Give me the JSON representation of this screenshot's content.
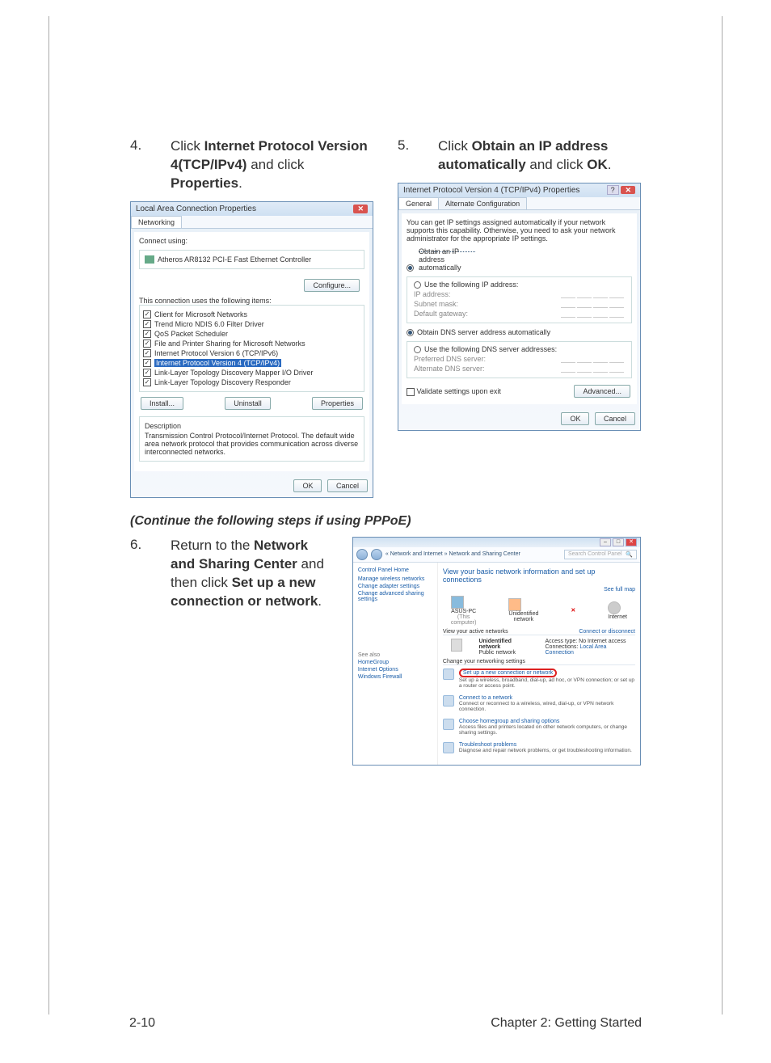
{
  "steps": {
    "s4": {
      "num": "4.",
      "text_pre": "Click ",
      "b1": "Internet Protocol Version 4(TCP/IPv4)",
      "mid": " and click ",
      "b2": "Properties",
      "post": "."
    },
    "s5": {
      "num": "5.",
      "text_pre": "Click ",
      "b1": "Obtain an IP address automatically",
      "mid": " and click ",
      "b2": "OK",
      "post": "."
    },
    "s6": {
      "num": "6.",
      "text_pre": "Return to the ",
      "b1": "Network and Sharing Center",
      "mid": " and then click ",
      "b2": "Set up a new connection or network",
      "post": "."
    }
  },
  "continue_note": "(Continue the following steps if using PPPoE)",
  "dlg1": {
    "title": "Local Area Connection Properties",
    "tab": "Networking",
    "connect_using": "Connect using:",
    "adapter": "Atheros AR8132 PCI-E Fast Ethernet Controller",
    "configure": "Configure...",
    "uses": "This connection uses the following items:",
    "items": [
      "Client for Microsoft Networks",
      "Trend Micro NDIS 6.0 Filter Driver",
      "QoS Packet Scheduler",
      "File and Printer Sharing for Microsoft Networks",
      "Internet Protocol Version 6 (TCP/IPv6)",
      "Internet Protocol Version 4 (TCP/IPv4)",
      "Link-Layer Topology Discovery Mapper I/O Driver",
      "Link-Layer Topology Discovery Responder"
    ],
    "install": "Install...",
    "uninstall": "Uninstall",
    "properties": "Properties",
    "desc_h": "Description",
    "desc": "Transmission Control Protocol/Internet Protocol. The default wide area network protocol that provides communication across diverse interconnected networks.",
    "ok": "OK",
    "cancel": "Cancel"
  },
  "dlg2": {
    "title": "Internet Protocol Version 4 (TCP/IPv4) Properties",
    "tab1": "General",
    "tab2": "Alternate Configuration",
    "intro": "You can get IP settings assigned automatically if your network supports this capability. Otherwise, you need to ask your network administrator for the appropriate IP settings.",
    "r_auto": "Obtain an IP address automatically",
    "r_use": "Use the following IP address:",
    "ip": "IP address:",
    "subnet": "Subnet mask:",
    "gw": "Default gateway:",
    "dns_auto": "Obtain DNS server address automatically",
    "dns_use": "Use the following DNS server addresses:",
    "pdns": "Preferred DNS server:",
    "adns": "Alternate DNS server:",
    "validate": "Validate settings upon exit",
    "advanced": "Advanced...",
    "ok": "OK",
    "cancel": "Cancel"
  },
  "cp": {
    "crumb": "« Network and Internet » Network and Sharing Center",
    "search_ph": "Search Control Panel",
    "side_home": "Control Panel Home",
    "side": [
      "Manage wireless networks",
      "Change adapter settings",
      "Change advanced sharing settings"
    ],
    "see_also": "See also",
    "see": [
      "HomeGroup",
      "Internet Options",
      "Windows Firewall"
    ],
    "h1": "View your basic network information and set up connections",
    "full_map": "See full map",
    "map": {
      "pc": "ASUS-PC",
      "pcsub": "(This computer)",
      "net": "Unidentified network",
      "inet": "Internet"
    },
    "active_h": "View your active networks",
    "connect_disc": "Connect or disconnect",
    "unid": "Unidentified network",
    "pub": "Public network",
    "access_l": "Access type:",
    "access_v": "No Internet access",
    "conn_l": "Connections:",
    "conn_v": "Local Area Connection",
    "change_h": "Change your networking settings",
    "o1": "Set up a new connection or network",
    "o1d": "Set up a wireless, broadband, dial-up, ad hoc, or VPN connection; or set up a router or access point.",
    "o2": "Connect to a network",
    "o2d": "Connect or reconnect to a wireless, wired, dial-up, or VPN network connection.",
    "o3": "Choose homegroup and sharing options",
    "o3d": "Access files and printers located on other network computers, or change sharing settings.",
    "o4": "Troubleshoot problems",
    "o4d": "Diagnose and repair network problems, or get troubleshooting information."
  },
  "footer": {
    "left": "2-10",
    "right": "Chapter 2: Getting Started"
  }
}
